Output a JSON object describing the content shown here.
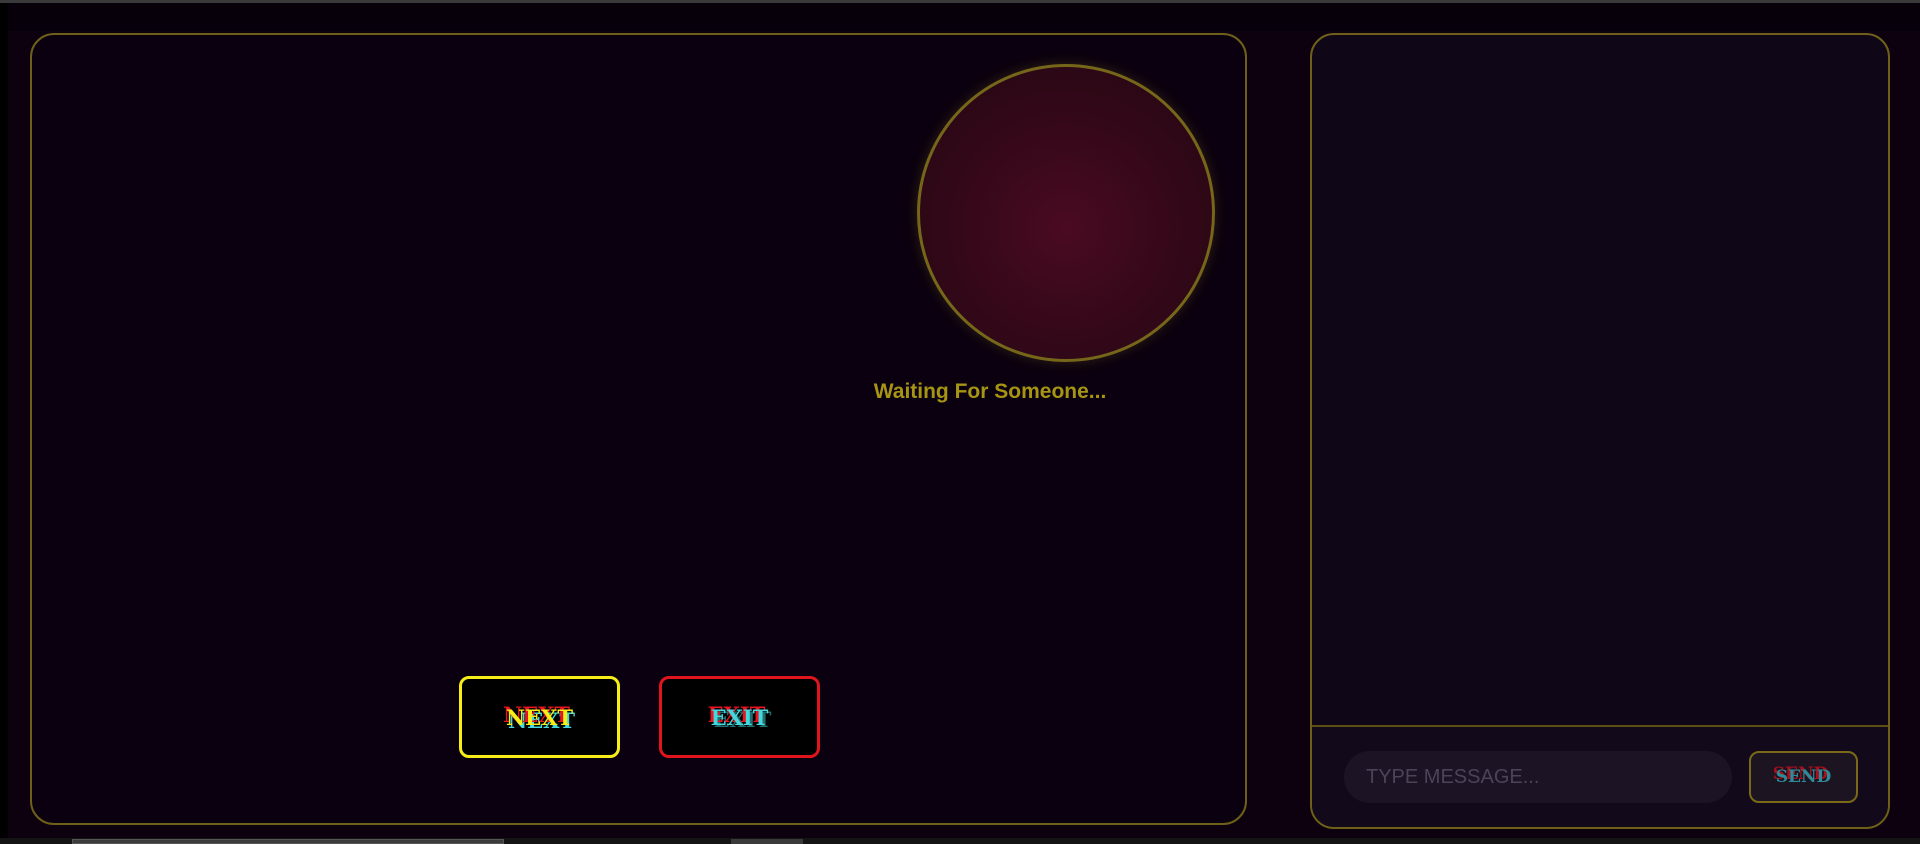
{
  "video": {
    "status_text": "Waiting For Someone..."
  },
  "controls": {
    "next_label": "NEXT",
    "exit_label": "EXIT"
  },
  "chat": {
    "input_placeholder": "TYPE MESSAGE...",
    "input_value": "",
    "send_label": "SEND"
  },
  "colors": {
    "accent_gold": "#a69413",
    "next_yellow": "#f5ee18",
    "exit_red": "#e0141c",
    "glitch_cyan": "#42d8dc",
    "panel_border": "#6e6018"
  }
}
